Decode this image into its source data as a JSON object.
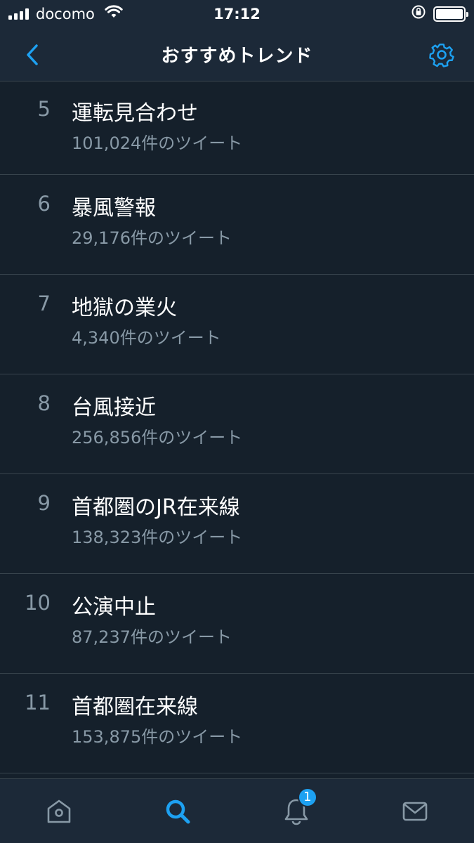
{
  "status_bar": {
    "carrier": "docomo",
    "time": "17:12",
    "battery_level": 1.0
  },
  "nav": {
    "title": "おすすめトレンド",
    "back_icon": "chevron-left-icon",
    "settings_icon": "gear-icon"
  },
  "trends": [
    {
      "rank": "5",
      "name": "運転見合わせ",
      "count": "101,024件のツイート"
    },
    {
      "rank": "6",
      "name": "暴風警報",
      "count": "29,176件のツイート"
    },
    {
      "rank": "7",
      "name": "地獄の業火",
      "count": "4,340件のツイート"
    },
    {
      "rank": "8",
      "name": "台風接近",
      "count": "256,856件のツイート"
    },
    {
      "rank": "9",
      "name": "首都圏のJR在来線",
      "count": "138,323件のツイート"
    },
    {
      "rank": "10",
      "name": "公演中止",
      "count": "87,237件のツイート"
    },
    {
      "rank": "11",
      "name": "首都圏在来線",
      "count": "153,875件のツイート"
    }
  ],
  "tab_bar": {
    "notifications_badge": "1",
    "active_tab": "search"
  },
  "colors": {
    "background": "#15202b",
    "bar": "#1c2938",
    "accent": "#1da1f2",
    "secondary_text": "#8899a6",
    "divider": "#38444d"
  }
}
